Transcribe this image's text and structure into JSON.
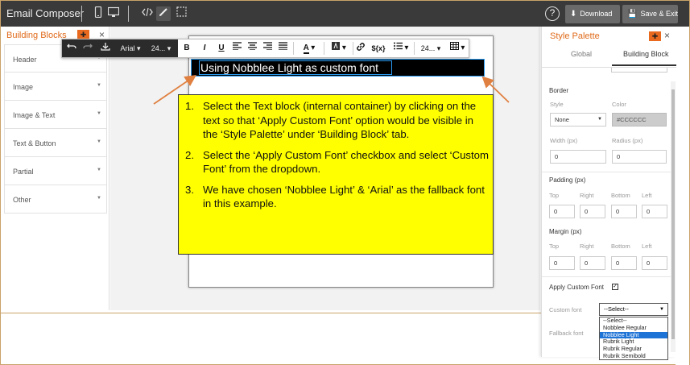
{
  "topbar": {
    "title": "Email Composer",
    "icons": [
      "mobile-icon",
      "desktop-icon",
      "code-icon",
      "pencil-icon",
      "select-icon"
    ],
    "help_label": "?",
    "download_label": "Download",
    "save_exit_label": "Save & Exit"
  },
  "left_panel": {
    "title": "Building Blocks",
    "close": "×",
    "items": [
      {
        "label": "Header"
      },
      {
        "label": "Image"
      },
      {
        "label": "Image & Text"
      },
      {
        "label": "Text & Button"
      },
      {
        "label": "Partial"
      },
      {
        "label": "Other"
      }
    ]
  },
  "toolbar": {
    "font_family": "Arial",
    "font_size": "24...",
    "line_height": "24...",
    "bold": "B",
    "italic": "I",
    "underline": "U",
    "text_color": "A",
    "merge_tag": "${x}"
  },
  "canvas": {
    "text_block": "Using Nobblee Light as custom font"
  },
  "callout": {
    "steps": [
      {
        "num": "1.",
        "text": "Select the Text block (internal container) by clicking on the text so that ‘Apply Custom Font’ option would be visible in the ‘Style Palette’ under ‘Building Block’ tab."
      },
      {
        "num": "2.",
        "text": "Select the ‘Apply Custom Font’ checkbox and select ‘Custom Font’ from the dropdown."
      },
      {
        "num": "3.",
        "text": "We have chosen ‘Nobblee Light’ & ‘Arial’ as the fallback font in this example."
      }
    ],
    "fill": "#ffff00"
  },
  "right_panel": {
    "title": "Style Palette",
    "close": "×",
    "tabs": [
      {
        "label": "Global"
      },
      {
        "label": "Building Block"
      }
    ],
    "active_tab": "Building Block",
    "border": {
      "title": "Border",
      "style_label": "Style",
      "color_label": "Color",
      "style_value": "None",
      "color_value": "#CCCCCC",
      "width_label": "Width (px)",
      "radius_label": "Radius (px)",
      "width_value": "0",
      "radius_value": "0"
    },
    "padding": {
      "title": "Padding (px)",
      "labels": [
        "Top",
        "Right",
        "Bottom",
        "Left"
      ],
      "values": [
        "0",
        "0",
        "0",
        "0"
      ]
    },
    "margin": {
      "title": "Margin (px)",
      "labels": [
        "Top",
        "Right",
        "Bottom",
        "Left"
      ],
      "values": [
        "0",
        "0",
        "0",
        "0"
      ]
    },
    "apply_custom_font_label": "Apply Custom Font",
    "apply_custom_font_checked": true,
    "custom_font_label": "Custom font",
    "custom_font_value": "--Select--",
    "fallback_font_label": "Fallback font",
    "dropdown_options": [
      "--Select--",
      "Nobblee Regular",
      "Nobblee Light",
      "Rubrik Light",
      "Rubrik Regular",
      "Rubrik Semibold"
    ],
    "dropdown_highlighted": "Nobblee Light"
  },
  "colors": {
    "accent": "#e06a1a",
    "topbar": "#3a3a3a",
    "selection": "#2a9df4",
    "arrow": "#e08040"
  }
}
